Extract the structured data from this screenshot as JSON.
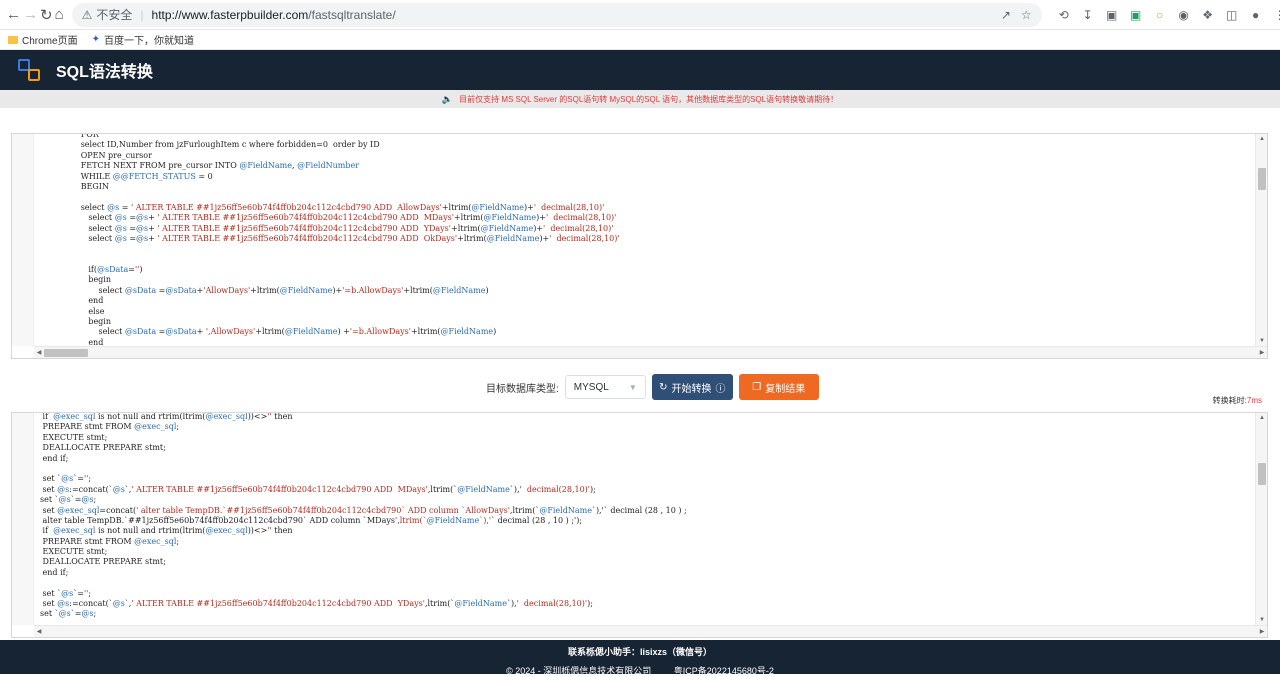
{
  "browser": {
    "insecure_label": "不安全",
    "url_host": "http://www.fasterpbuilder.com",
    "url_path": "/fastsqltranslate/",
    "bookmarks": [
      "Chrome页面",
      "百度一下，你就知道"
    ]
  },
  "header": {
    "title": "SQL语法转换"
  },
  "notice": {
    "text": "目前仅支持 MS SQL Server 的SQL语句转 MySQL的SQL 语句，其他数据库类型的SQL语句转换敬请期待！"
  },
  "source_editor": {
    "lines": [
      {
        "n": "19",
        "t": "                FOR"
      },
      {
        "n": "20",
        "t": "                select ID,Number from jzFurloughItem c where forbidden=0  order by ID"
      },
      {
        "n": "21",
        "t": "                OPEN pre_cursor"
      },
      {
        "n": "22",
        "t": "                FETCH NEXT FROM pre_cursor INTO @FieldName, @FieldNumber"
      },
      {
        "n": "23",
        "t": "                WHILE @@FETCH_STATUS = 0"
      },
      {
        "n": "24",
        "t": "                BEGIN"
      },
      {
        "n": "25",
        "t": ""
      },
      {
        "n": "26",
        "t": "                select @s = ' ALTER TABLE ##1jz56ff5e60b74f4ff0b204c112c4cbd790 ADD  AllowDays'+ltrim(@FieldName)+'  decimal(28,10)'"
      },
      {
        "n": "27",
        "t": "                   select @s =@s+ ' ALTER TABLE ##1jz56ff5e60b74f4ff0b204c112c4cbd790 ADD  MDays'+ltrim(@FieldName)+'  decimal(28,10)'"
      },
      {
        "n": "28",
        "t": "                   select @s =@s+ ' ALTER TABLE ##1jz56ff5e60b74f4ff0b204c112c4cbd790 ADD  YDays'+ltrim(@FieldName)+'  decimal(28,10)'"
      },
      {
        "n": "29",
        "t": "                   select @s =@s+ ' ALTER TABLE ##1jz56ff5e60b74f4ff0b204c112c4cbd790 ADD  OkDays'+ltrim(@FieldName)+'  decimal(28,10)'"
      },
      {
        "n": "30",
        "t": ""
      },
      {
        "n": "31",
        "t": ""
      },
      {
        "n": "32",
        "t": "                   if(@sData='')"
      },
      {
        "n": "33",
        "t": "                   begin"
      },
      {
        "n": "34",
        "t": "                       select @sData =@sData+'AllowDays'+ltrim(@FieldName)+'=b.AllowDays'+ltrim(@FieldName)"
      },
      {
        "n": "35",
        "t": "                   end"
      },
      {
        "n": "36",
        "t": "                   else"
      },
      {
        "n": "37",
        "t": "                   begin"
      },
      {
        "n": "38",
        "t": "                       select @sData =@sData+ ',AllowDays'+ltrim(@FieldName) +'=b.AllowDays'+ltrim(@FieldName)"
      },
      {
        "n": "39",
        "t": "                   end"
      }
    ]
  },
  "controls": {
    "db_type_label": "目标数据库类型:",
    "db_type_value": "MYSQL",
    "convert_label": "开始转换",
    "copy_label": "复制结果",
    "timing_label": "转换耗时:",
    "timing_value": "7ms"
  },
  "result_editor": {
    "lines": [
      {
        "n": "38",
        "t": " if  @exec_sql is not null and rtrim(ltrim(@exec_sql))<>'' then"
      },
      {
        "n": "39",
        "t": " PREPARE stmt FROM @exec_sql;"
      },
      {
        "n": "40",
        "t": " EXECUTE stmt;"
      },
      {
        "n": "41",
        "t": " DEALLOCATE PREPARE stmt;"
      },
      {
        "n": "42",
        "t": " end if;"
      },
      {
        "n": "43",
        "t": ""
      },
      {
        "n": "44",
        "t": " set `@s`='';"
      },
      {
        "n": "45",
        "t": " set @s:=concat(`@s`,' ALTER TABLE ##1jz56ff5e60b74f4ff0b204c112c4cbd790 ADD  MDays',ltrim(`@FieldName`),'  decimal(28,10)');"
      },
      {
        "n": "46",
        "t": "set `@s`=@s;"
      },
      {
        "n": "47",
        "t": " set @exec_sql=concat(' alter table TempDB.`##1jz56ff5e60b74f4ff0b204c112c4cbd790` ADD column `AllowDays',ltrim(`@FieldName`),'` decimal (28 , 10 ) ;"
      },
      {
        "n": "48",
        "t": " alter table TempDB.`##1jz56ff5e60b74f4ff0b204c112c4cbd790` ADD column `MDays',ltrim(`@FieldName`),'` decimal (28 , 10 ) ;');"
      },
      {
        "n": "49",
        "t": " if  @exec_sql is not null and rtrim(ltrim(@exec_sql))<>'' then"
      },
      {
        "n": "50",
        "t": " PREPARE stmt FROM @exec_sql;"
      },
      {
        "n": "51",
        "t": " EXECUTE stmt;"
      },
      {
        "n": "52",
        "t": " DEALLOCATE PREPARE stmt;"
      },
      {
        "n": "53",
        "t": " end if;"
      },
      {
        "n": "54",
        "t": ""
      },
      {
        "n": "55",
        "t": " set `@s`='';"
      },
      {
        "n": "56",
        "t": " set @s:=concat(`@s`,' ALTER TABLE ##1jz56ff5e60b74f4ff0b204c112c4cbd790 ADD  YDays',ltrim(`@FieldName`),'  decimal(28,10)');"
      },
      {
        "n": "57",
        "t": "set `@s`=@s;"
      },
      {
        "n": "58",
        "t": ""
      }
    ]
  },
  "footer": {
    "contact": "联系栎偲小助手：lisixzs（微信号）",
    "copyright": "© 2024 - 深圳栎偲信息技术有限公司",
    "icp": "粤ICP备2022145680号-2"
  }
}
